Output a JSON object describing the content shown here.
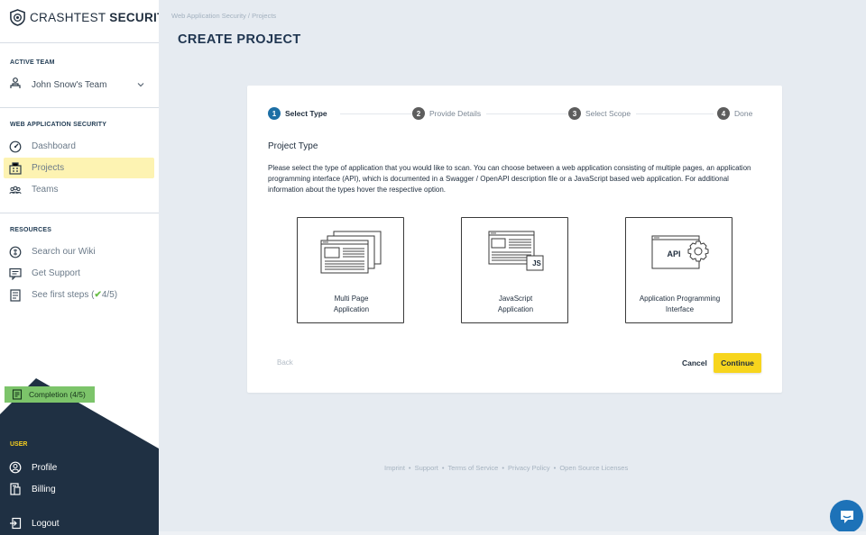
{
  "brand": {
    "name_light": "CRASHTEST ",
    "name_bold": "SECURITY"
  },
  "sidebar": {
    "active_team_label": "ACTIVE TEAM",
    "team_name": "John Snow's Team",
    "was_label": "WEB APPLICATION SECURITY",
    "was_items": [
      {
        "label": "Dashboard",
        "icon": "dashboard-icon"
      },
      {
        "label": "Projects",
        "icon": "projects-icon",
        "active": true
      },
      {
        "label": "Teams",
        "icon": "teams-icon"
      }
    ],
    "resources_label": "RESOURCES",
    "resources_items": [
      {
        "label": "Search our Wiki",
        "icon": "wiki-icon"
      },
      {
        "label": "Get Support",
        "icon": "support-icon"
      },
      {
        "label_prefix": "See first steps (",
        "check": "✔",
        "label_suffix": "4/5)",
        "icon": "first-steps-icon"
      }
    ],
    "completion": "Completion (4/5)",
    "user_label": "USER",
    "user_items": [
      {
        "label": "Profile",
        "icon": "profile-icon"
      },
      {
        "label": "Billing",
        "icon": "billing-icon"
      },
      {
        "label": "Logout",
        "icon": "logout-icon"
      }
    ]
  },
  "main": {
    "breadcrumb": "Web Application Security / Projects",
    "title": "CREATE PROJECT",
    "steps": [
      {
        "num": "1",
        "label": "Select Type",
        "active": true
      },
      {
        "num": "2",
        "label": "Provide Details",
        "active": false
      },
      {
        "num": "3",
        "label": "Select Scope",
        "active": false
      },
      {
        "num": "4",
        "label": "Done",
        "active": false
      }
    ],
    "project_type_heading": "Project Type",
    "description": "Please select the type of application that you would like to scan. You can choose between a web application consisting of multiple pages, an application programming interface (API), which is documented in a Swagger / OpenAPI description file or a JavaScript based web application. For additional information about the types hover the respective option.",
    "types": [
      {
        "label": "Multi Page\nApplication",
        "icon": "multi-page-icon"
      },
      {
        "label": "JavaScript\nApplication",
        "icon": "javascript-app-icon",
        "badge": "JS"
      },
      {
        "label": "Application Programming\nInterface",
        "icon": "api-icon",
        "badge": "API"
      }
    ],
    "back": "Back",
    "cancel": "Cancel",
    "continue": "Continue"
  },
  "footer": {
    "links": [
      "Imprint",
      "Support",
      "Terms of Service",
      "Privacy Policy",
      "Open Source Licenses"
    ],
    "separator": "•"
  },
  "colors": {
    "sidebar_dark": "#1f3043",
    "accent_yellow": "#f7d51d",
    "step_active": "#1d6fa5",
    "completion_green": "#7cc46a",
    "chat_blue": "#1d72b8"
  }
}
